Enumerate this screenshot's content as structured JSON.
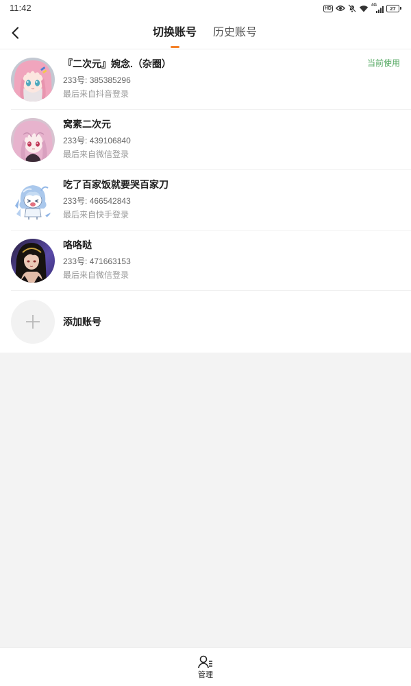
{
  "status_bar": {
    "time": "11:42",
    "hd_badge": "HD",
    "network_type": "4G",
    "battery_level": "27",
    "icons": [
      "hd-icon",
      "eye-icon",
      "bell-off-icon",
      "wifi-icon",
      "signal-icon",
      "battery-icon"
    ]
  },
  "header": {
    "back_icon": "chevron-left-icon",
    "tabs": [
      {
        "label": "切换账号",
        "active": true
      },
      {
        "label": "历史账号",
        "active": false
      }
    ]
  },
  "accounts": [
    {
      "name": "『二次元』婉念.（杂圈）",
      "account_id": "233号: 385385296",
      "last_login": "最后来自抖音登录",
      "status": "当前使用",
      "is_current": true
    },
    {
      "name": "窝素二次元",
      "account_id": "233号: 439106840",
      "last_login": "最后来自微信登录",
      "is_current": false
    },
    {
      "name": "吃了百家饭就要哭百家刀",
      "account_id": "233号: 466542843",
      "last_login": "最后来自快手登录",
      "is_current": false
    },
    {
      "name": "咯咯哒",
      "account_id": "233号: 471663153",
      "last_login": "最后来自微信登录",
      "is_current": false
    }
  ],
  "add_account": {
    "label": "添加账号",
    "icon": "plus-icon"
  },
  "bottom_nav": {
    "items": [
      {
        "label": "管理",
        "icon": "user-manage-icon"
      }
    ]
  },
  "colors": {
    "tab_indicator": "#f5822a",
    "current_status": "#52a760",
    "page_background": "#f3f3f3",
    "surface": "#ffffff"
  }
}
